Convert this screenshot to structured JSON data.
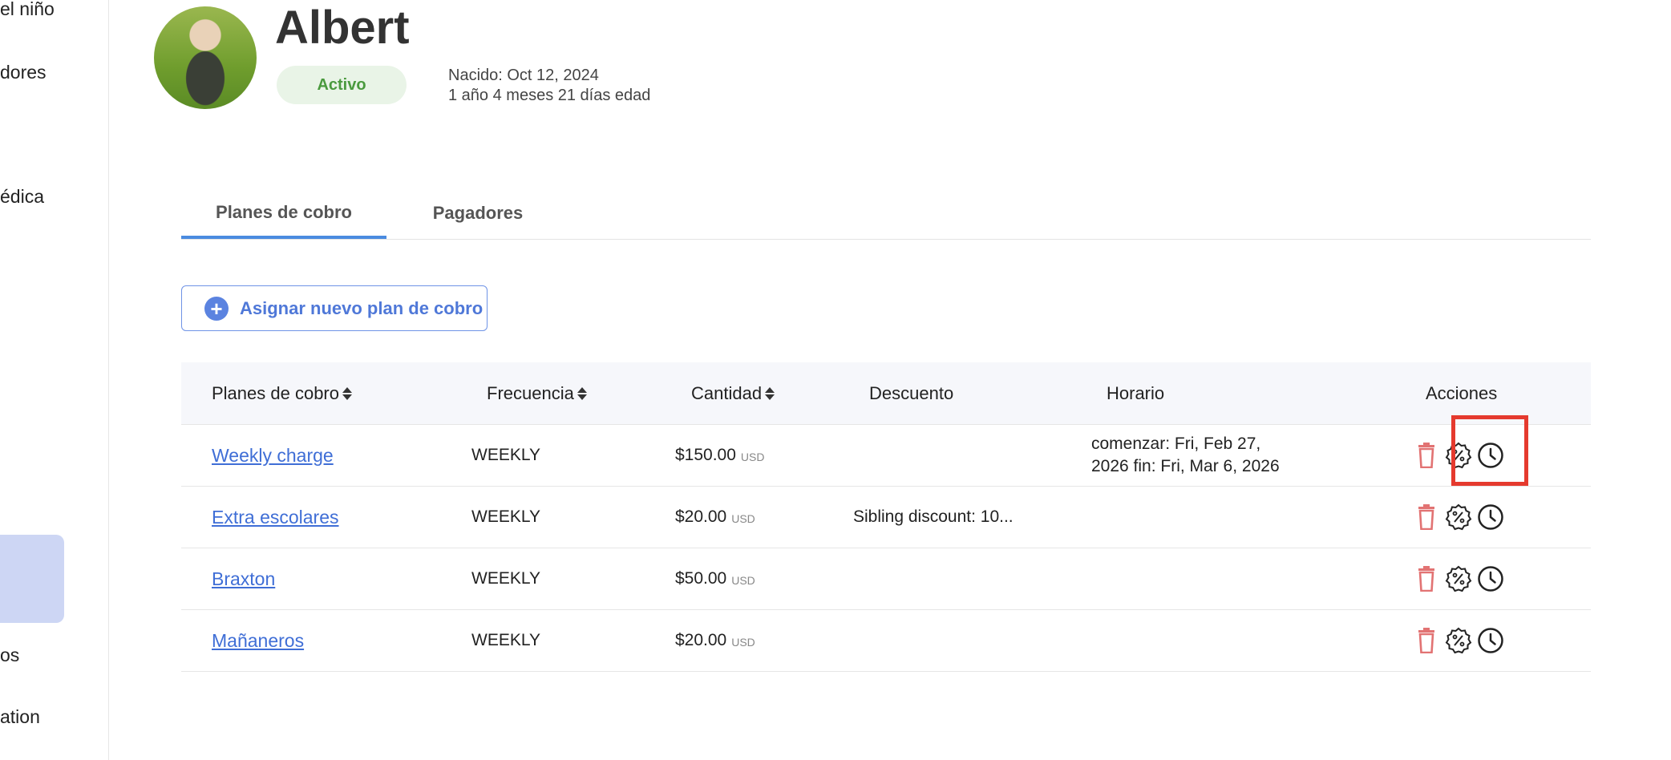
{
  "sidebar": {
    "items": [
      {
        "label": "el niño"
      },
      {
        "label": "dores"
      },
      {
        "label": "édica"
      },
      {
        "label": "os"
      },
      {
        "label": "ation"
      }
    ]
  },
  "profile": {
    "name": "Albert",
    "status": "Activo",
    "born": "Nacido: Oct 12, 2024",
    "age": "1 año 4 meses 21 días edad"
  },
  "tabs": [
    {
      "label": "Planes de cobro",
      "active": true
    },
    {
      "label": "Pagadores",
      "active": false
    }
  ],
  "assign_button": {
    "label": "Asignar nuevo plan de cobro",
    "icon": "plus-circle-icon"
  },
  "table": {
    "headers": {
      "plan": "Planes de cobro",
      "frequency": "Frecuencia",
      "amount": "Cantidad",
      "discount": "Descuento",
      "schedule": "Horario",
      "actions": "Acciones"
    },
    "rows": [
      {
        "plan": "Weekly charge",
        "frequency": "WEEKLY",
        "amount": "$150.00",
        "currency": "USD",
        "discount": "",
        "schedule_line1": "comenzar: Fri, Feb 27,",
        "schedule_line2": "2026 fin: Fri, Mar 6, 2026"
      },
      {
        "plan": "Extra escolares",
        "frequency": "WEEKLY",
        "amount": "$20.00",
        "currency": "USD",
        "discount": "Sibling discount: 10...",
        "schedule_line1": "",
        "schedule_line2": ""
      },
      {
        "plan": "Braxton",
        "frequency": "WEEKLY",
        "amount": "$50.00",
        "currency": "USD",
        "discount": "",
        "schedule_line1": "",
        "schedule_line2": ""
      },
      {
        "plan": "Mañaneros",
        "frequency": "WEEKLY",
        "amount": "$20.00",
        "currency": "USD",
        "discount": "",
        "schedule_line1": "",
        "schedule_line2": ""
      }
    ]
  },
  "colors": {
    "accent": "#4a8be0",
    "link": "#3f6ed6",
    "delete": "#e27373",
    "highlight": "#e53a2e",
    "status_bg": "#e9f4e7",
    "status_text": "#4a9a3e"
  },
  "icons": {
    "delete": "trash-icon",
    "discount": "percent-badge-icon",
    "schedule": "clock-icon"
  }
}
